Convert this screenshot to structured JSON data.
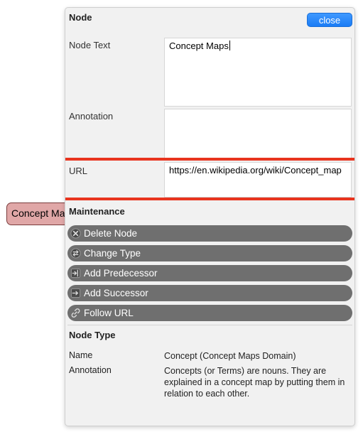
{
  "canvas": {
    "node_label": "Concept Maps",
    "node_color": "#e0a7a7"
  },
  "panel": {
    "title": "Node",
    "close_label": "close",
    "fields": {
      "node_text_label": "Node Text",
      "node_text_value": "Concept Maps",
      "annotation_label": "Annotation",
      "annotation_value": "",
      "url_label": "URL",
      "url_value": "https://en.wikipedia.org/wiki/Concept_map"
    },
    "maintenance": {
      "title": "Maintenance",
      "actions": [
        {
          "label": "Delete Node",
          "icon": "delete-circle-icon"
        },
        {
          "label": "Change Type",
          "icon": "change-type-icon"
        },
        {
          "label": "Add Predecessor",
          "icon": "add-predecessor-icon"
        },
        {
          "label": "Add Successor",
          "icon": "add-successor-icon"
        },
        {
          "label": "Follow URL",
          "icon": "link-icon"
        }
      ]
    },
    "node_type": {
      "title": "Node Type",
      "name_label": "Name",
      "name_value": "Concept (Concept Maps Domain)",
      "annotation_label": "Annotation",
      "annotation_value": "Concepts (or Terms) are nouns. They are explained in a concept map by putting them in relation to each other."
    }
  },
  "colors": {
    "close_button": "#1a7cf5",
    "action_button": "#6f6f6f",
    "highlight": "#e8341e"
  }
}
